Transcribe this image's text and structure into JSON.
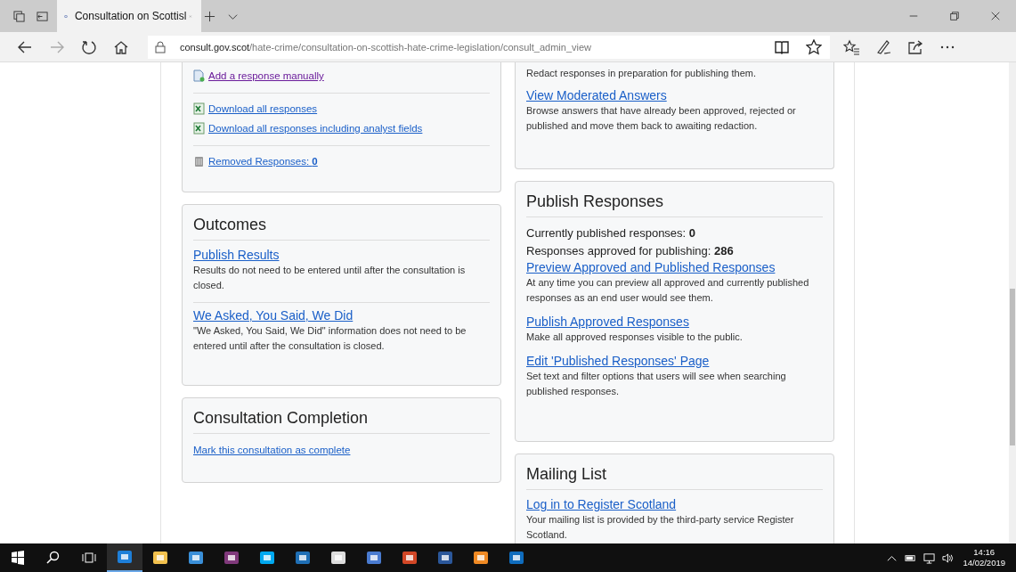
{
  "browser": {
    "tab_title": "Consultation on Scottisl",
    "url_domain": "consult.gov.scot",
    "url_path": "/hate-crime/consultation-on-scottish-hate-crime-legislation/consult_admin_view"
  },
  "columns": [
    {
      "cards": [
        {
          "blocks": [
            {
              "kind": "add-link",
              "text": "Add a response manually",
              "visited": true
            },
            {
              "kind": "rule"
            },
            {
              "kind": "download-link",
              "text": "Download all responses",
              "visited": false
            },
            {
              "kind": "download-link",
              "text": "Download all responses including analyst fields",
              "visited": false
            },
            {
              "kind": "rule"
            },
            {
              "kind": "removed-link",
              "text": "Removed Responses: **0**",
              "visited": false
            }
          ]
        },
        {
          "title": "Outcomes",
          "blocks": [
            {
              "kind": "entry",
              "link": "Publish Results",
              "description": "Results do not need to be entered until after the consultation is closed."
            },
            {
              "kind": "rule"
            },
            {
              "kind": "entry",
              "link": "We Asked, You Said, We Did",
              "description": "\"We Asked, You Said, We Did\" information does not need to be entered until after the consultation is closed."
            }
          ]
        },
        {
          "title": "Consultation Completion",
          "blocks": [
            {
              "kind": "small-link",
              "text": "Mark this consultation as complete"
            }
          ]
        }
      ]
    },
    {
      "cards": [
        {
          "blocks": [
            {
              "kind": "text",
              "text": "Redact responses in preparation for publishing them."
            },
            {
              "kind": "entry",
              "link": "View Moderated Answers",
              "description": "Browse answers that have already been approved, rejected or published and move them back to awaiting redaction."
            }
          ]
        },
        {
          "title": "Publish Responses",
          "blocks": [
            {
              "kind": "stat",
              "text": "Currently published responses: **0**"
            },
            {
              "kind": "stat",
              "text": "Responses approved for publishing: **286**"
            },
            {
              "kind": "entry",
              "link": "Preview Approved and Published Responses",
              "description": "At any time you can preview all approved and currently published responses as an end user would see them."
            },
            {
              "kind": "entry",
              "link": "Publish Approved Responses",
              "description": "Make all approved responses visible to the public."
            },
            {
              "kind": "entry",
              "link": "Edit 'Published Responses' Page",
              "description": "Set text and filter options that users will see when searching published responses."
            }
          ]
        },
        {
          "title": "Mailing List",
          "blocks": [
            {
              "kind": "entry",
              "link": "Log in to Register Scotland",
              "description": "Your mailing list is provided by the third-party service Register Scotland."
            }
          ]
        }
      ]
    }
  ],
  "taskbar": {
    "time": "14:16",
    "date": "14/02/2019"
  }
}
